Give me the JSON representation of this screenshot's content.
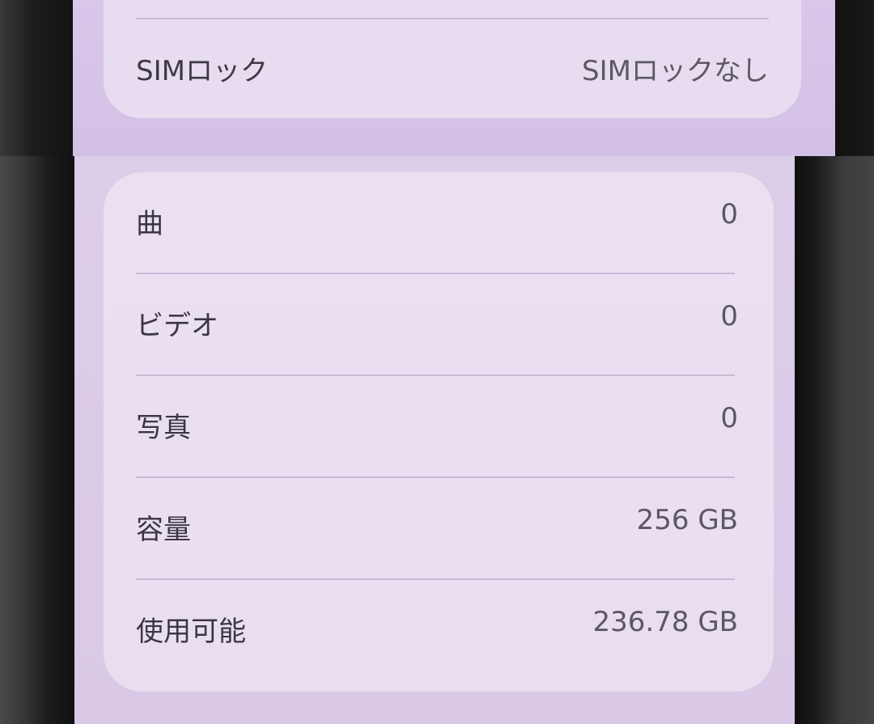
{
  "top_section": {
    "sim_lock": {
      "label": "SIMロック",
      "value": "SIMロックなし"
    }
  },
  "storage_section": {
    "rows": [
      {
        "label": "曲",
        "value": "0"
      },
      {
        "label": "ビデオ",
        "value": "0"
      },
      {
        "label": "写真",
        "value": "0"
      },
      {
        "label": "容量",
        "value": "256 GB"
      },
      {
        "label": "使用可能",
        "value": "236.78 GB"
      }
    ]
  },
  "colors": {
    "screen_tint": "#d9c7ea",
    "card": "#e9def0",
    "separator": "#c8b9d6",
    "label_text": "#3a3642",
    "value_text": "#5c5765",
    "device_frame": "#111111"
  }
}
